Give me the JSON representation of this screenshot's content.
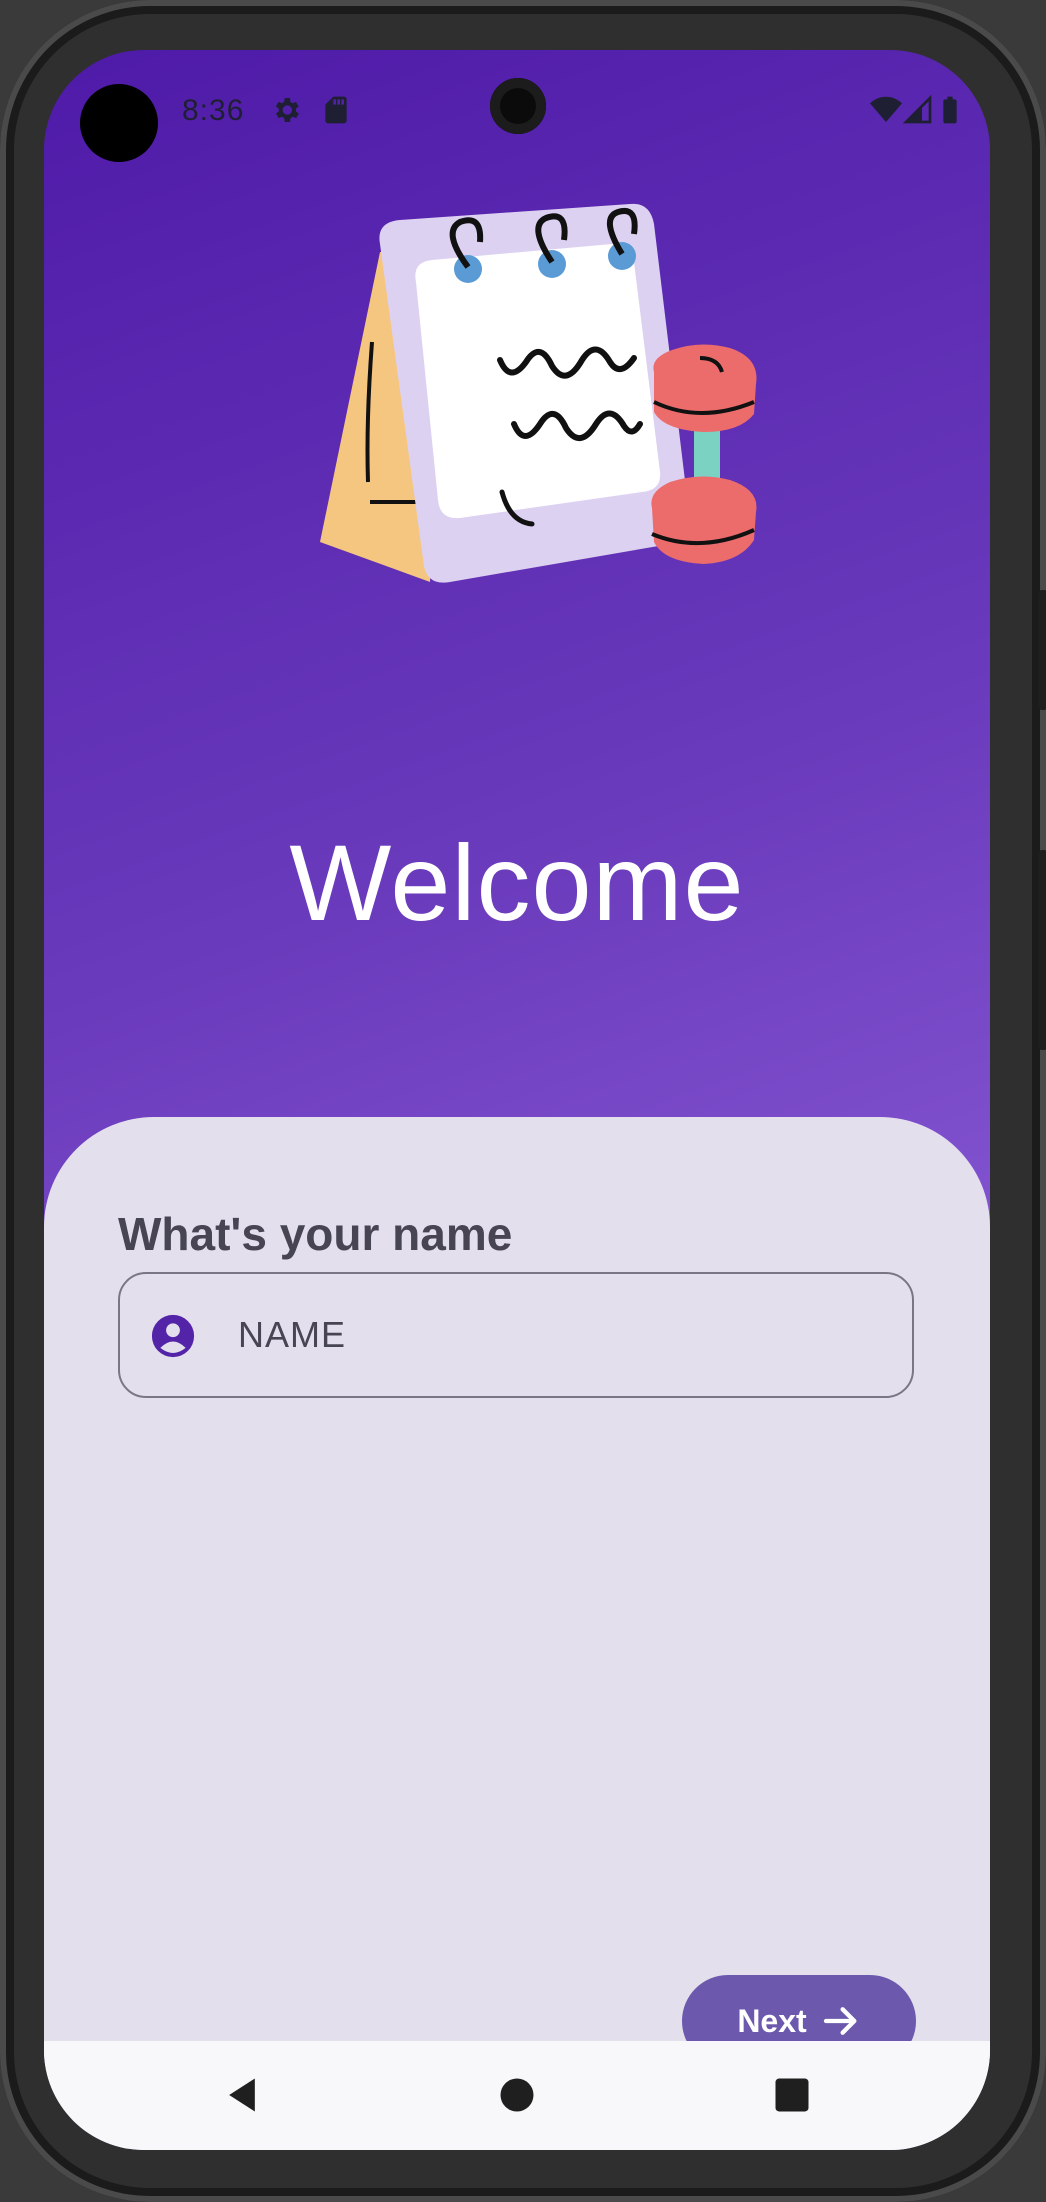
{
  "status_bar": {
    "time": "8:36",
    "left_icons": [
      "settings-icon",
      "sd-card-icon"
    ],
    "right_icons": [
      "wifi-icon",
      "cell-signal-icon",
      "battery-icon"
    ]
  },
  "hero": {
    "illustration": "calendar-with-dumbbell-illustration"
  },
  "welcome_title": "Welcome",
  "form": {
    "title": "What's your name",
    "name_field": {
      "placeholder": "NAME",
      "icon": "account-circle-icon"
    }
  },
  "next_button": {
    "label": "Next",
    "icon": "arrow-right-icon"
  },
  "nav_bar": {
    "buttons": [
      "back-icon",
      "home-icon",
      "recents-icon"
    ]
  },
  "colors": {
    "gradient_start": "#4e1aa8",
    "gradient_end": "#9a6ee0",
    "sheet_background": "#e4dfec",
    "button_background": "#6c58ad",
    "field_icon": "#5323a8"
  }
}
